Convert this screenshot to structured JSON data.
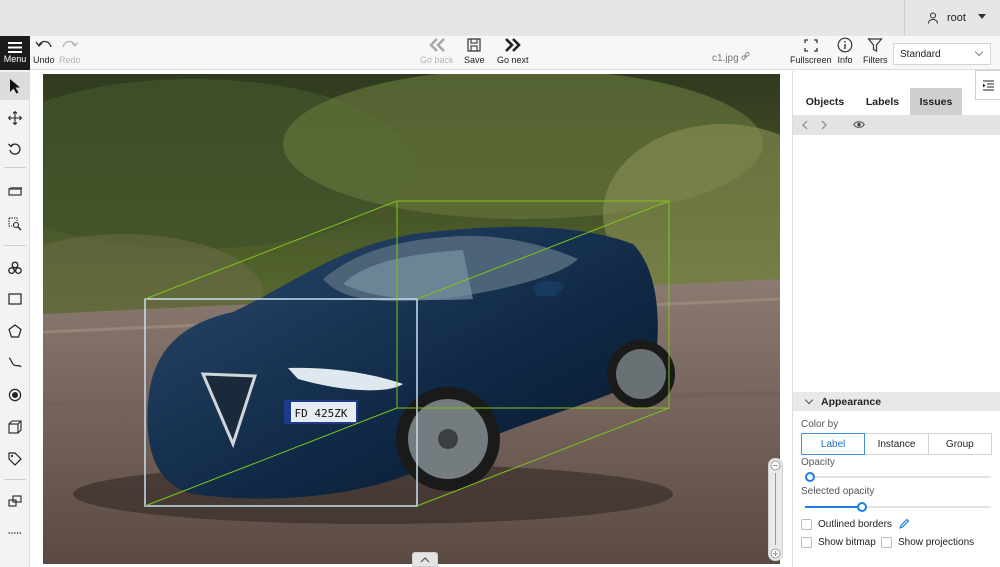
{
  "user": {
    "name": "root"
  },
  "toolbar": {
    "menu_label": "Menu",
    "undo_label": "Undo",
    "redo_label": "Redo",
    "go_back_label": "Go back",
    "save_label": "Save",
    "go_next_label": "Go next",
    "file_name": "c1.jpg",
    "fullscreen_label": "Fullscreen",
    "info_label": "Info",
    "filters_label": "Filters",
    "workspace_value": "Standard"
  },
  "sidebar": {
    "tools": [
      "cursor-icon",
      "move-icon",
      "rotate-icon",
      "fit-image-icon",
      "zoom-region-icon",
      "magic-tool-icon",
      "rectangle-icon",
      "polygon-icon",
      "polyline-icon",
      "points-icon",
      "cuboid-icon",
      "tag-icon",
      "merge-icon",
      "split-icon"
    ]
  },
  "canvas": {
    "plate_text": "FD 425ZK",
    "cuboid_color": "#7fc31c",
    "front_face_color": "#c9dff0"
  },
  "panel": {
    "tabs": [
      "Objects",
      "Labels",
      "Issues"
    ],
    "active_tab": "Issues",
    "appearance_title": "Appearance",
    "color_by_label": "Color by",
    "color_by_options": [
      "Label",
      "Instance",
      "Group"
    ],
    "color_by_selected": "Label",
    "opacity_label": "Opacity",
    "opacity_value": 0.0,
    "selected_opacity_label": "Selected opacity",
    "selected_opacity_value": 0.4,
    "outlined_borders_label": "Outlined borders",
    "show_bitmap_label": "Show bitmap",
    "show_projections_label": "Show projections"
  }
}
